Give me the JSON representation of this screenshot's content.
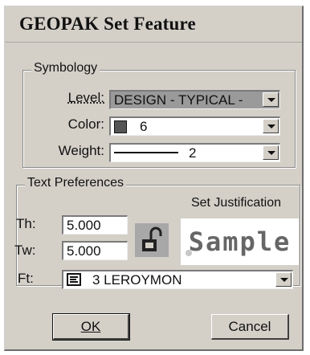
{
  "window": {
    "title": "GEOPAK Set Feature"
  },
  "symbology": {
    "legend": "Symbology",
    "level_label": "Level:",
    "level_value": "DESIGN - TYPICAL -",
    "color_label": "Color:",
    "color_value": "6",
    "color_swatch": "#555555",
    "weight_label": "Weight:",
    "weight_value": "2"
  },
  "text_preferences": {
    "legend": "Text Preferences",
    "set_justification": "Set Justification",
    "th_label": "Th:",
    "th_value": "5.000",
    "tw_label": "Tw:",
    "tw_value": "5.000",
    "ft_label": "Ft:",
    "ft_value": "3 LEROYMON",
    "sample_text": "Sample"
  },
  "buttons": {
    "ok": "OK",
    "cancel": "Cancel"
  }
}
